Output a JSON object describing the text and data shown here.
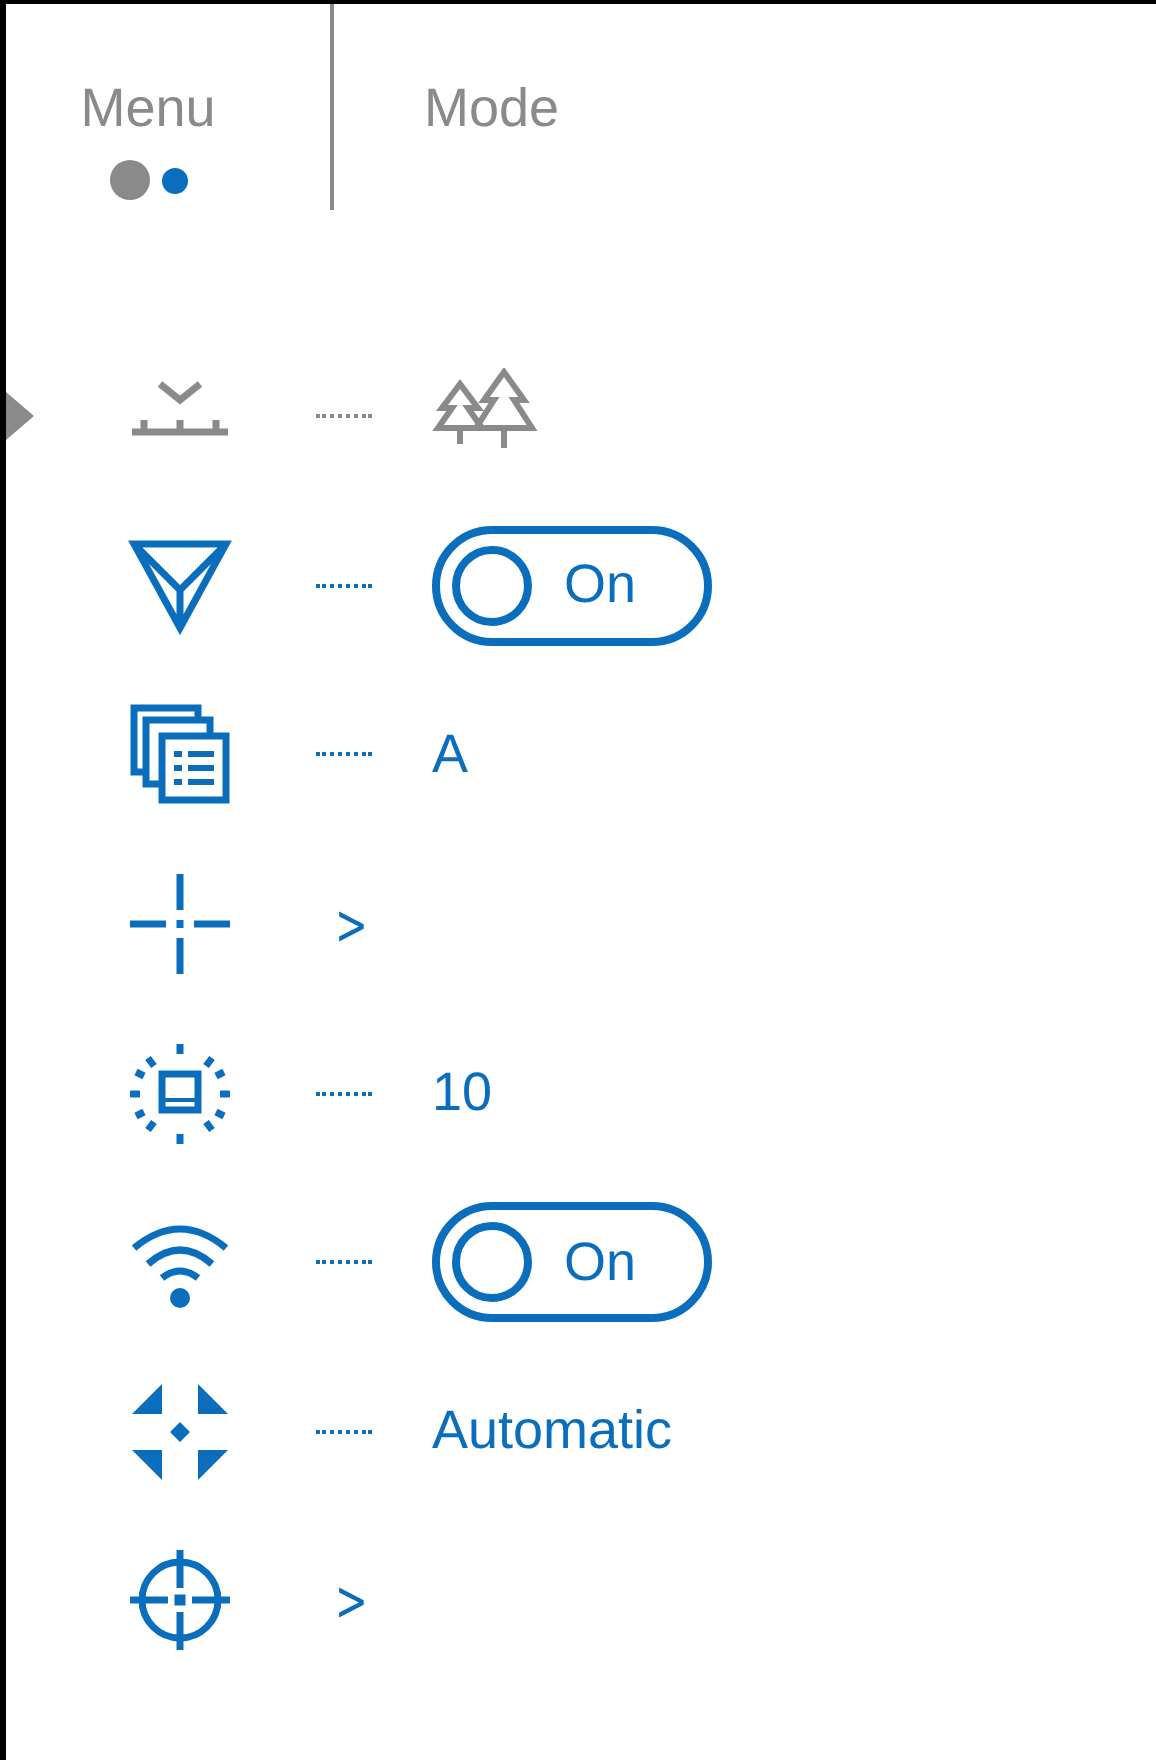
{
  "header": {
    "tabs": [
      {
        "label": "Menu"
      },
      {
        "label": "Mode"
      }
    ],
    "page_dots": [
      {
        "selected": false
      },
      {
        "selected": true
      }
    ]
  },
  "items": [
    {
      "selected": true,
      "kind": "icon"
    },
    {
      "selected": false,
      "kind": "toggle",
      "on": true,
      "label": "On"
    },
    {
      "selected": false,
      "kind": "text",
      "value": "A"
    },
    {
      "selected": false,
      "kind": "submenu",
      "arrow": ">"
    },
    {
      "selected": false,
      "kind": "text",
      "value": "10"
    },
    {
      "selected": false,
      "kind": "toggle",
      "on": true,
      "label": "On"
    },
    {
      "selected": false,
      "kind": "text",
      "value": "Automatic"
    },
    {
      "selected": false,
      "kind": "submenu",
      "arrow": ">"
    }
  ]
}
